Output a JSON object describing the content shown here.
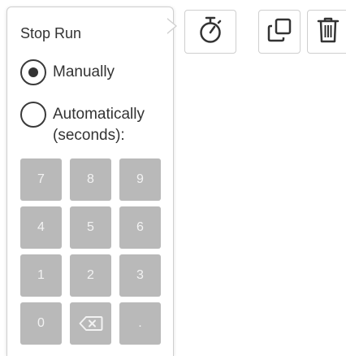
{
  "popover": {
    "title": "Stop Run",
    "options": [
      {
        "label": "Manually",
        "selected": true
      },
      {
        "label": "Automatically (seconds):",
        "line1": "Automatically",
        "line2": "(seconds):",
        "selected": false
      }
    ]
  },
  "keypad": {
    "keys": [
      {
        "label": "7"
      },
      {
        "label": "8"
      },
      {
        "label": "9"
      },
      {
        "label": "4"
      },
      {
        "label": "5"
      },
      {
        "label": "6"
      },
      {
        "label": "1"
      },
      {
        "label": "2"
      },
      {
        "label": "3"
      },
      {
        "label": "0"
      },
      {
        "label": "",
        "icon": "backspace-icon"
      },
      {
        "label": "."
      }
    ]
  },
  "toolbar": {
    "buttons": [
      {
        "icon": "stopwatch-icon"
      },
      {
        "icon": "copy-icon"
      },
      {
        "icon": "trash-icon"
      }
    ]
  },
  "colors": {
    "key_background": "#b9b9b9",
    "key_text": "#f2f2f2",
    "text": "#333333",
    "border": "#cfcfcf"
  }
}
